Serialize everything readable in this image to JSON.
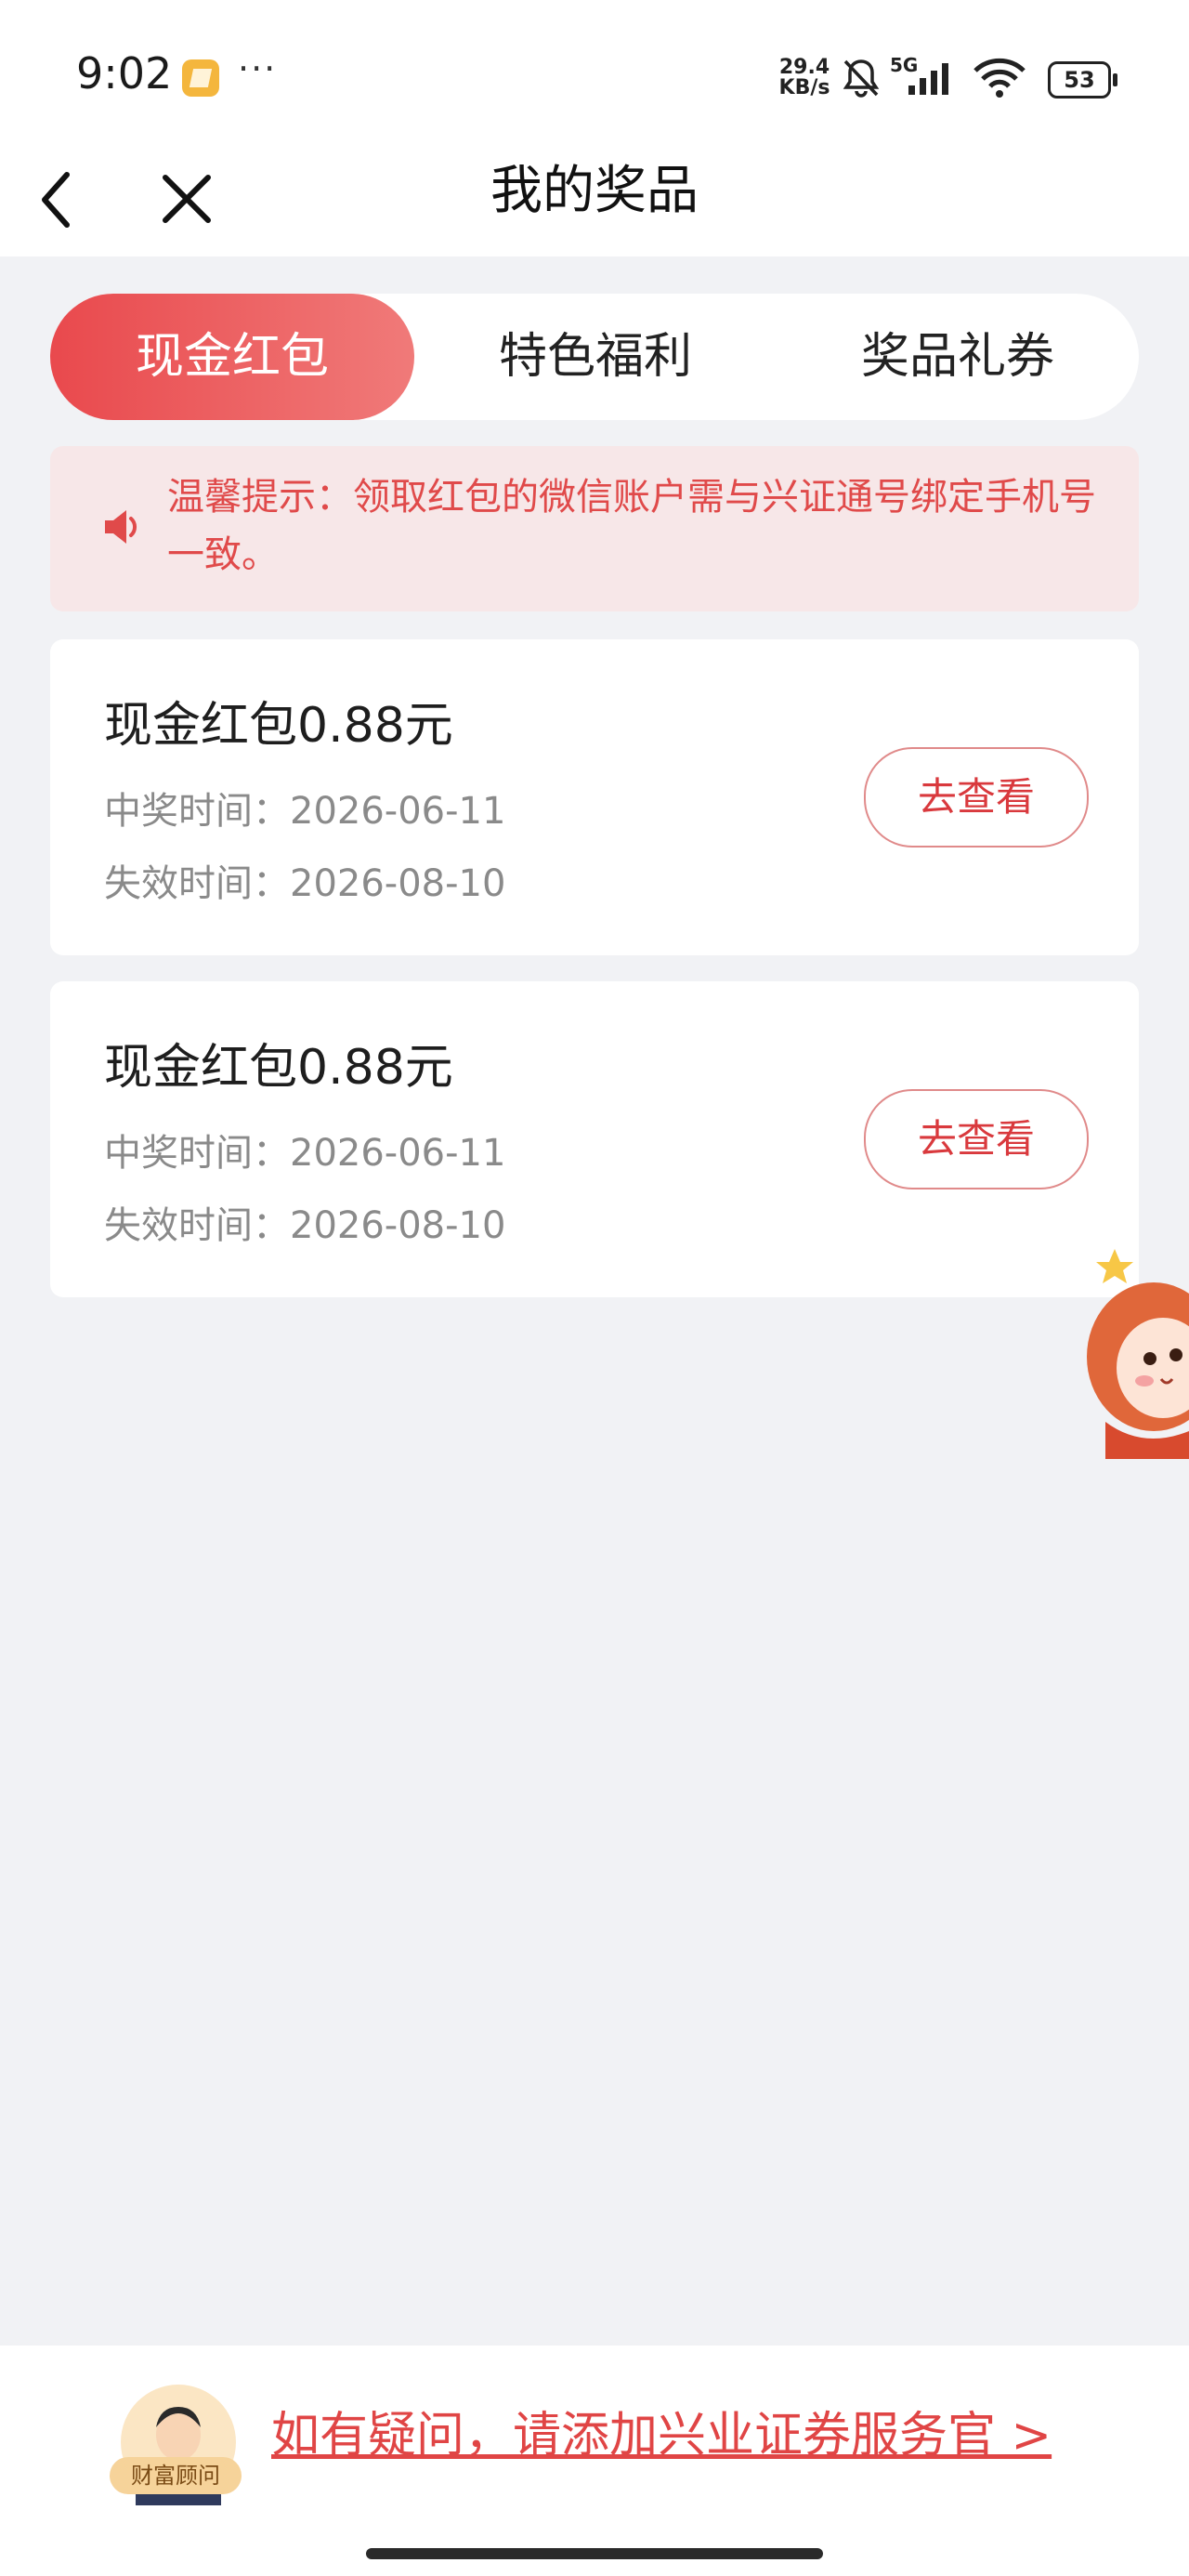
{
  "status_bar": {
    "time": "9:02",
    "net_speed_value": "29.4",
    "net_speed_unit": "KB/s",
    "network": "5G",
    "battery": "53"
  },
  "nav": {
    "title": "我的奖品"
  },
  "tabs": [
    {
      "label": "现金红包",
      "active": true
    },
    {
      "label": "特色福利",
      "active": false
    },
    {
      "label": "奖品礼券",
      "active": false
    }
  ],
  "notice": {
    "text": "温馨提示：领取红包的微信账户需与兴证通号绑定手机号一致。"
  },
  "prizes": [
    {
      "title": "现金红包0.88元",
      "win_time": "中奖时间：2026-06-11",
      "expire_time": "失效时间：2026-08-10",
      "button": "去查看"
    },
    {
      "title": "现金红包0.88元",
      "win_time": "中奖时间：2026-06-11",
      "expire_time": "失效时间：2026-08-10",
      "button": "去查看"
    }
  ],
  "footer": {
    "advisor_badge": "财富顾问",
    "link_text": "如有疑问，请添加兴业证券服务官 >"
  },
  "colors": {
    "accent": "#e9494d",
    "notice_bg": "#f7e7e8",
    "page_bg": "#f1f2f5"
  }
}
